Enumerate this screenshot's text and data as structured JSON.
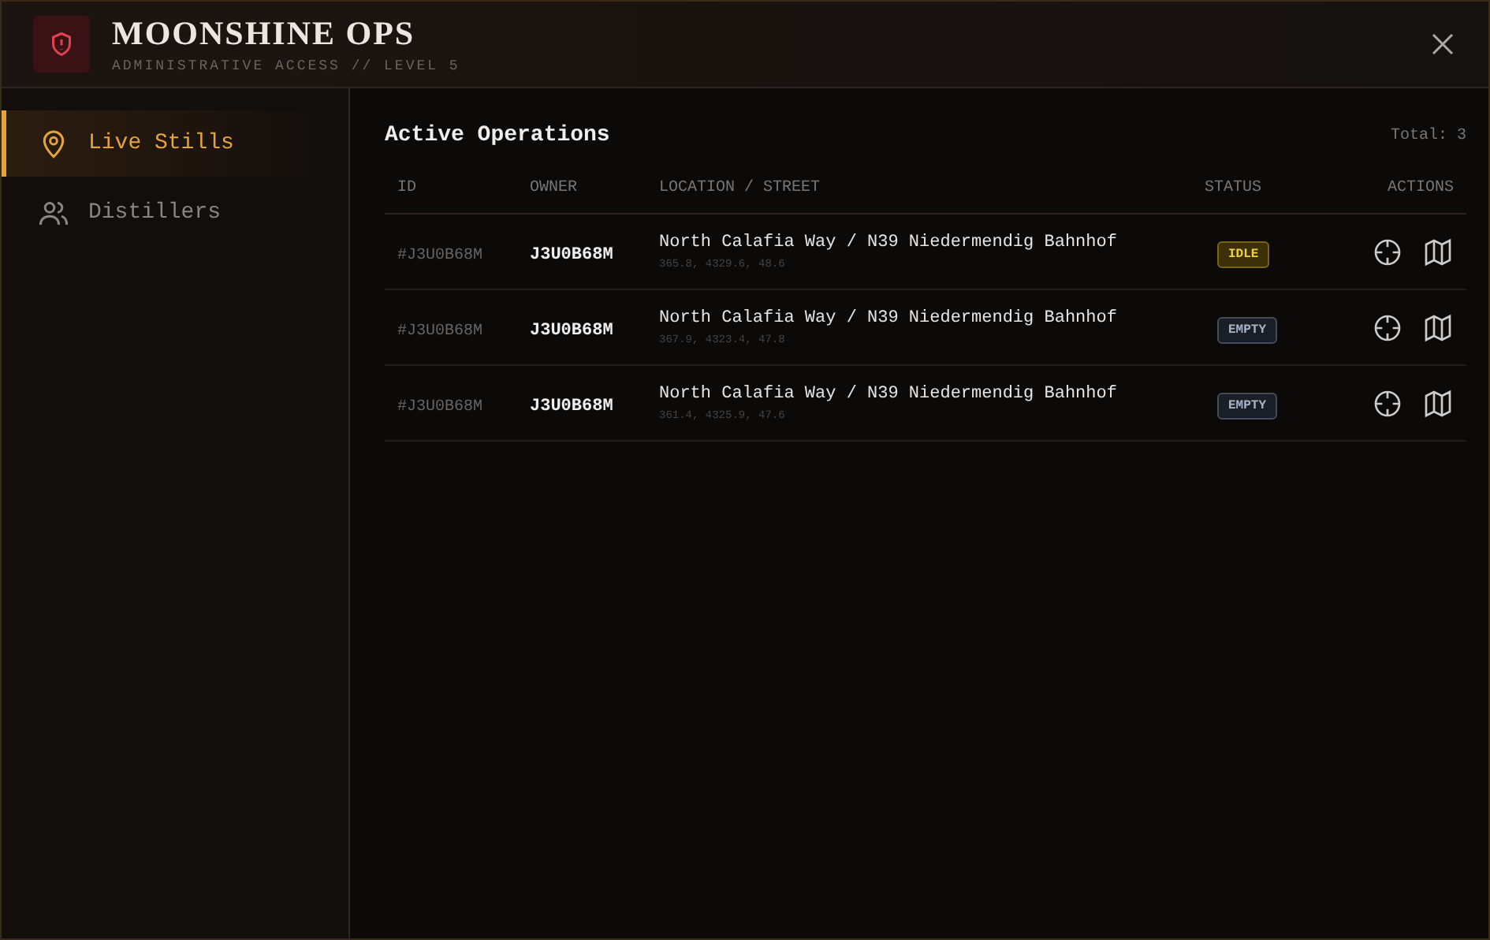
{
  "header": {
    "title": "MOONSHINE OPS",
    "subtitle": "ADMINISTRATIVE ACCESS // LEVEL 5"
  },
  "sidebar": {
    "items": [
      {
        "label": "Live Stills",
        "kind": "pin",
        "selected": true
      },
      {
        "label": "Distillers",
        "kind": "users",
        "selected": false
      }
    ]
  },
  "main": {
    "heading": "Active Operations",
    "total": "Total: 3",
    "table": {
      "columns": [
        "ID",
        "OWNER",
        "LOCATION / STREET",
        "STATUS",
        "ACTIONS"
      ],
      "rows": [
        {
          "id": "#J3U0B68M",
          "owner": "J3U0B68M",
          "location": "North Calafia Way / N39 Niedermendig Bahnhof",
          "coords": "365.8, 4329.6, 48.6",
          "status": "IDLE",
          "kind": "idle"
        },
        {
          "id": "#J3U0B68M",
          "owner": "J3U0B68M",
          "location": "North Calafia Way / N39 Niedermendig Bahnhof",
          "coords": "367.9, 4323.4, 47.8",
          "status": "EMPTY",
          "kind": "empty"
        },
        {
          "id": "#J3U0B68M",
          "owner": "J3U0B68M",
          "location": "North Calafia Way / N39 Niedermendig Bahnhof",
          "coords": "361.4, 4325.9, 47.6",
          "status": "EMPTY",
          "kind": "empty"
        }
      ]
    }
  }
}
